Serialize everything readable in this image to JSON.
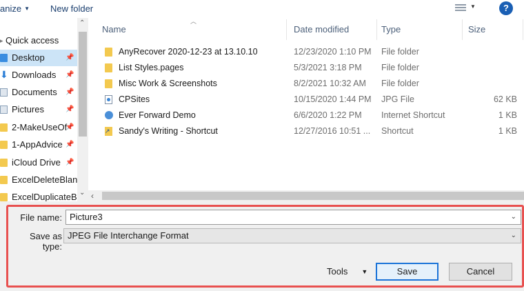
{
  "toolbar": {
    "organize_label": "anize",
    "new_folder_label": "New folder",
    "help_label": "?"
  },
  "nav": {
    "items": [
      {
        "label": "Quick access",
        "icon": "star-icon"
      },
      {
        "label": "Desktop",
        "icon": "folder-blue-icon",
        "selected": true
      },
      {
        "label": "Downloads",
        "icon": "download-icon"
      },
      {
        "label": "Documents",
        "icon": "documents-icon"
      },
      {
        "label": "Pictures",
        "icon": "pictures-icon"
      },
      {
        "label": "2-MakeUseOf",
        "icon": "folder-icon"
      },
      {
        "label": "1-AppAdvice",
        "icon": "folder-icon"
      },
      {
        "label": "iCloud Drive",
        "icon": "folder-icon"
      },
      {
        "label": "ExcelDeleteBlanl",
        "icon": "folder-icon"
      },
      {
        "label": "ExcelDuplicateBl",
        "icon": "folder-icon"
      }
    ]
  },
  "columns": {
    "name": "Name",
    "date": "Date modified",
    "type": "Type",
    "size": "Size"
  },
  "files": [
    {
      "name": "AnyRecover 2020-12-23 at 13.10.10",
      "date": "12/23/2020 1:10 PM",
      "type": "File folder",
      "size": "",
      "icon": "folder-icon"
    },
    {
      "name": "List Styles.pages",
      "date": "5/3/2021 3:18 PM",
      "type": "File folder",
      "size": "",
      "icon": "folder-icon"
    },
    {
      "name": "Misc Work & Screenshots",
      "date": "8/2/2021 10:32 AM",
      "type": "File folder",
      "size": "",
      "icon": "folder-icon"
    },
    {
      "name": "CPSites",
      "date": "10/15/2020 1:44 PM",
      "type": "JPG File",
      "size": "62 KB",
      "icon": "image-file-icon"
    },
    {
      "name": "Ever Forward Demo",
      "date": "6/6/2020 1:22 PM",
      "type": "Internet Shortcut",
      "size": "1 KB",
      "icon": "web-shortcut-icon"
    },
    {
      "name": "Sandy's Writing - Shortcut",
      "date": "12/27/2016 10:51 ...",
      "type": "Shortcut",
      "size": "1 KB",
      "icon": "shortcut-icon"
    }
  ],
  "save": {
    "file_name_label": "File name:",
    "file_name_value": "Picture3",
    "save_type_label": "Save as type:",
    "save_type_value": "JPEG File Interchange Format",
    "tools_label": "Tools",
    "save_button": "Save",
    "cancel_button": "Cancel"
  },
  "colors": {
    "highlight": "#e8504f",
    "selection": "#cce4f7",
    "accent": "#1a73d8"
  }
}
